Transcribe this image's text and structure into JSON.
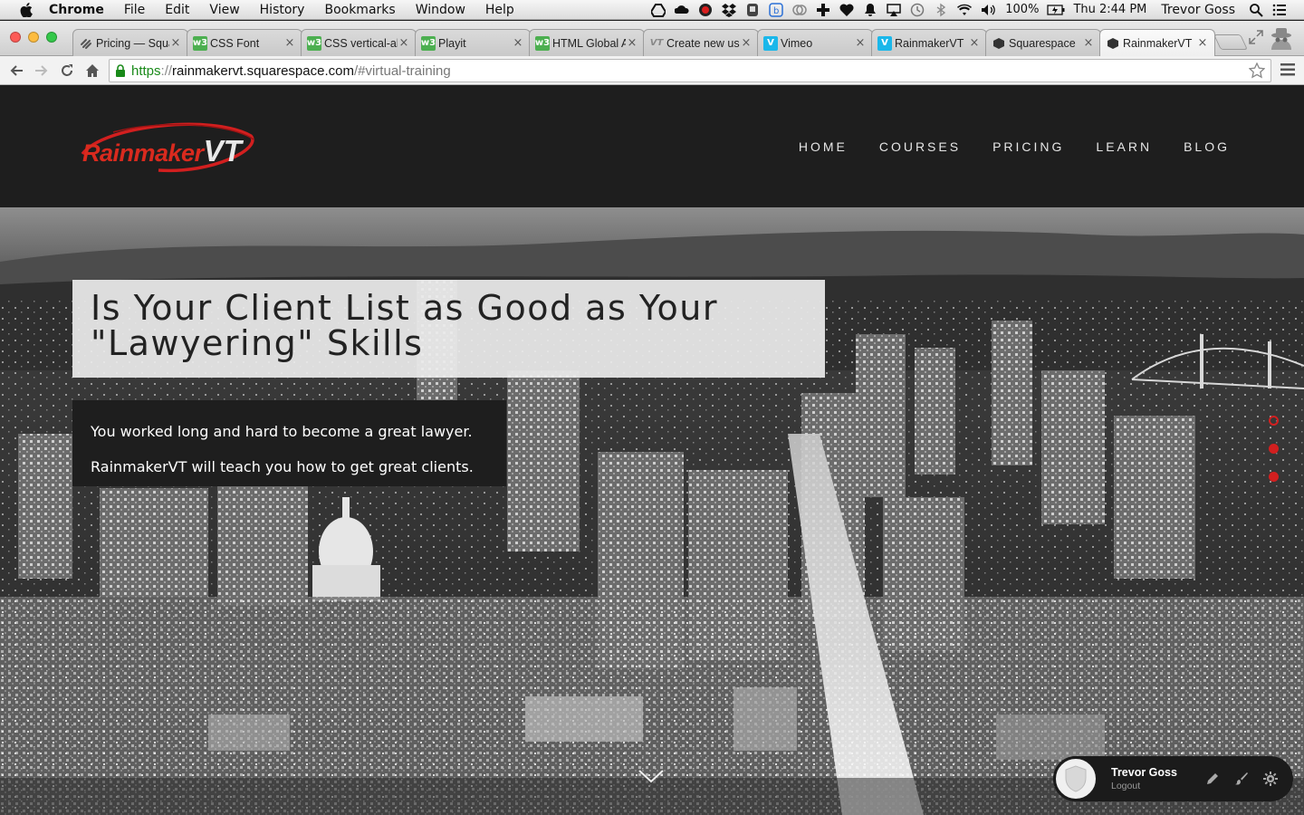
{
  "menubar": {
    "app_name": "Chrome",
    "items": [
      "File",
      "Edit",
      "View",
      "History",
      "Bookmarks",
      "Window",
      "Help"
    ],
    "battery": "100%",
    "clock": "Thu 2:44 PM",
    "user": "Trevor Goss",
    "tray_icons": [
      "google-drive-icon",
      "creative-cloud-icon",
      "record-icon",
      "dropbox-icon",
      "evernote-icon",
      "b-app-icon",
      "cloud-sync-icon",
      "plus-app-icon",
      "heart-icon",
      "notification-bell-icon",
      "airplay-icon",
      "time-machine-icon",
      "bluetooth-icon",
      "wifi-icon",
      "volume-icon",
      "battery-icon",
      "spotlight-search-icon",
      "notification-center-icon"
    ]
  },
  "tabs": [
    {
      "title": "Pricing — Squarespace",
      "favicon": "squarespace-icon",
      "color": "#555555",
      "active": false
    },
    {
      "title": "CSS Font",
      "favicon": "w3schools-icon",
      "color": "#4caf50",
      "active": false
    },
    {
      "title": "CSS vertical-align",
      "favicon": "w3schools-icon",
      "color": "#4caf50",
      "active": false
    },
    {
      "title": "Playit",
      "favicon": "w3schools-icon",
      "color": "#4caf50",
      "active": false
    },
    {
      "title": "HTML Global Attributes",
      "favicon": "w3schools-icon",
      "color": "#4caf50",
      "active": false
    },
    {
      "title": "Create new user",
      "favicon": "vt-icon",
      "color": "#888888",
      "active": false
    },
    {
      "title": "Vimeo",
      "favicon": "vimeo-icon",
      "color": "#1ab7ea",
      "active": false
    },
    {
      "title": "RainmakerVT",
      "favicon": "vimeo-icon",
      "color": "#1ab7ea",
      "active": false
    },
    {
      "title": "Squarespace",
      "favicon": "squarespace-icon",
      "color": "#333333",
      "active": false
    },
    {
      "title": "RainmakerVT",
      "favicon": "squarespace-icon",
      "color": "#333333",
      "active": true
    }
  ],
  "address": {
    "scheme": "https",
    "separator": "://",
    "host": "rainmakervt.squarespace.com",
    "path": "/#virtual-training"
  },
  "site": {
    "logo_text": "Rainmaker",
    "logo_text_vt": "VT",
    "nav": [
      "HOME",
      "COURSES",
      "PRICING",
      "LEARN",
      "BLOG"
    ],
    "headline": "Is Your Client List as Good as Your \"Lawyering\" Skills",
    "sub_line_1": "You worked long and hard to become a great lawyer.",
    "sub_line_2": "RainmakerVT will teach you how to get great clients.",
    "accent_color": "#d21f1f"
  },
  "userbar": {
    "name": "Trevor Goss",
    "logout": "Logout"
  }
}
